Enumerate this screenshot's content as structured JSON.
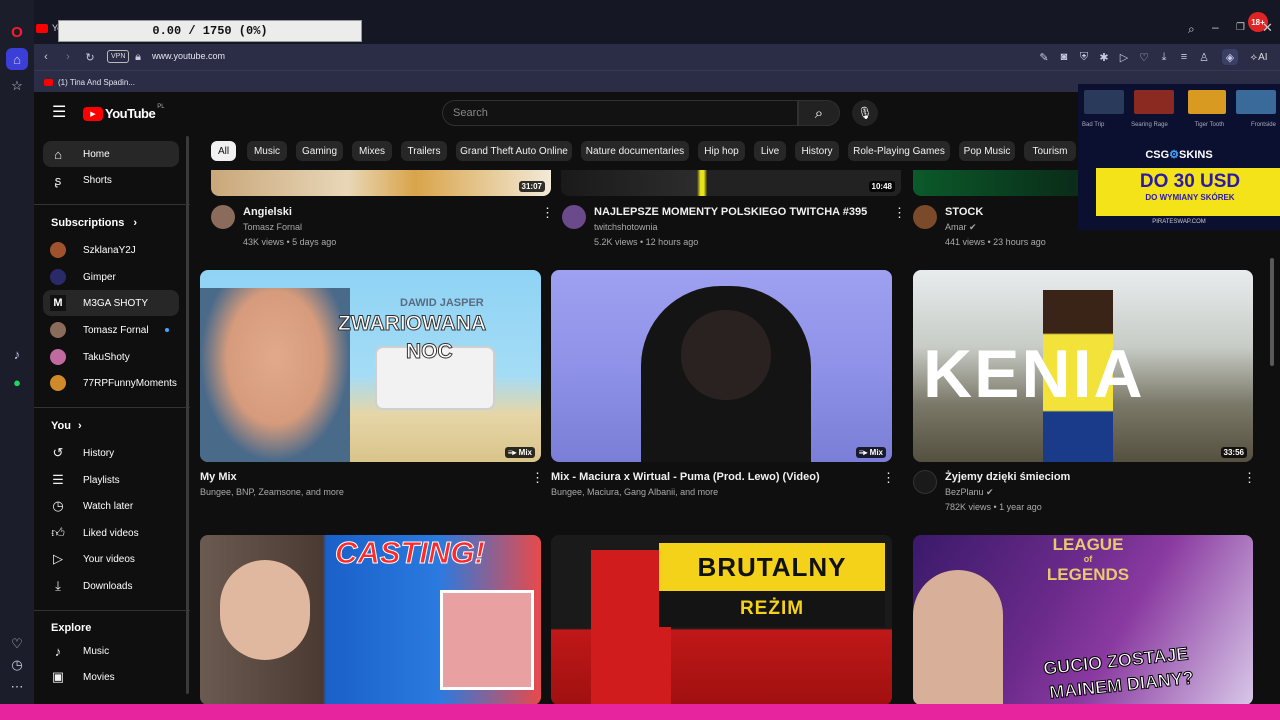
{
  "progress": "0.00 / 1750 (0%)",
  "browser": {
    "url": "www.youtube.com",
    "vpn_label": "VPN",
    "tab_title": "Yo",
    "bookmark": "(1) Tina And Spadin...",
    "ai_label": "AI",
    "notif_badge": "18+"
  },
  "youtube": {
    "logo_text": "YouTube",
    "logo_region": "PL",
    "search_placeholder": "Search",
    "chips": [
      "All",
      "Music",
      "Gaming",
      "Mixes",
      "Trailers",
      "Grand Theft Auto Online",
      "Nature documentaries",
      "Hip hop",
      "Live",
      "History",
      "Role-Playing Games",
      "Pop Music",
      "Tourism"
    ],
    "sidebar": {
      "main": [
        {
          "label": "Home",
          "icon": "home-icon"
        },
        {
          "label": "Shorts",
          "icon": "shorts-icon"
        }
      ],
      "subs_title": "Subscriptions",
      "subs": [
        "SzklanaY2J",
        "Gimper",
        "M3GA SHOTY",
        "Tomasz Fornal",
        "TakuShoty",
        "77RPFunnyMoments"
      ],
      "you_title": "You",
      "you": [
        {
          "label": "History",
          "icon": "history-icon"
        },
        {
          "label": "Playlists",
          "icon": "playlists-icon"
        },
        {
          "label": "Watch later",
          "icon": "clock-icon"
        },
        {
          "label": "Liked videos",
          "icon": "thumb-up-icon"
        },
        {
          "label": "Your videos",
          "icon": "play-icon"
        },
        {
          "label": "Downloads",
          "icon": "download-icon"
        }
      ],
      "explore_title": "Explore",
      "explore": [
        {
          "label": "Music",
          "icon": "music-icon"
        },
        {
          "label": "Movies",
          "icon": "movies-icon"
        }
      ]
    },
    "videos_top": [
      {
        "title": "Angielski",
        "channel": "Tomasz Fornal",
        "meta": "43K views • 5 days ago",
        "duration": "31:07"
      },
      {
        "title": "NAJLEPSZE MOMENTY POLSKIEGO TWITCHA #395",
        "channel": "twitchshotownia",
        "meta": "5.2K views • 12 hours ago",
        "duration": "10:48"
      },
      {
        "title": "STOCK",
        "channel": "Amar",
        "meta": "441 views • 23 hours ago",
        "duration": ""
      }
    ],
    "videos_mid": [
      {
        "title": "My Mix",
        "channel": "Bungee, BNP, Zeamsone, and more",
        "meta": "",
        "badge": "Mix",
        "overlay1": "DAWID JASPER",
        "overlay2": "ZWARIOWANA",
        "overlay3": "NOC"
      },
      {
        "title": "Mix - Maciura x Wirtual - Puma (Prod. Lewo) (Video)",
        "channel": "Bungee, Maciura, Gang Albanii, and more",
        "meta": "",
        "badge": "Mix"
      },
      {
        "title": "Żyjemy dzięki śmieciom",
        "channel": "BezPlanu",
        "meta": "782K views • 1 year ago",
        "duration": "33:56",
        "overlay1": "KENIA"
      }
    ],
    "videos_bottom": [
      {
        "overlay": "CASTING!"
      },
      {
        "overlay1": "BRUTALNY",
        "overlay2": "REŻIM"
      },
      {
        "overlay1": "LEAGUE",
        "overlay2": "of",
        "overlay3": "LEGENDS",
        "overlay4": "GUCIO ZOSTAJE",
        "overlay5": "MAINEM DIANY?"
      }
    ]
  },
  "ad": {
    "brand": "CSG",
    "brand2": "SKINS",
    "headline": "DO 30 USD",
    "sub": "DO WYMIANY SKÓREK",
    "url": "PIRATESWAP.COM",
    "items": [
      "Bad Trip",
      "Searing Rage",
      "Tiger Tooth",
      "Frontside"
    ]
  }
}
